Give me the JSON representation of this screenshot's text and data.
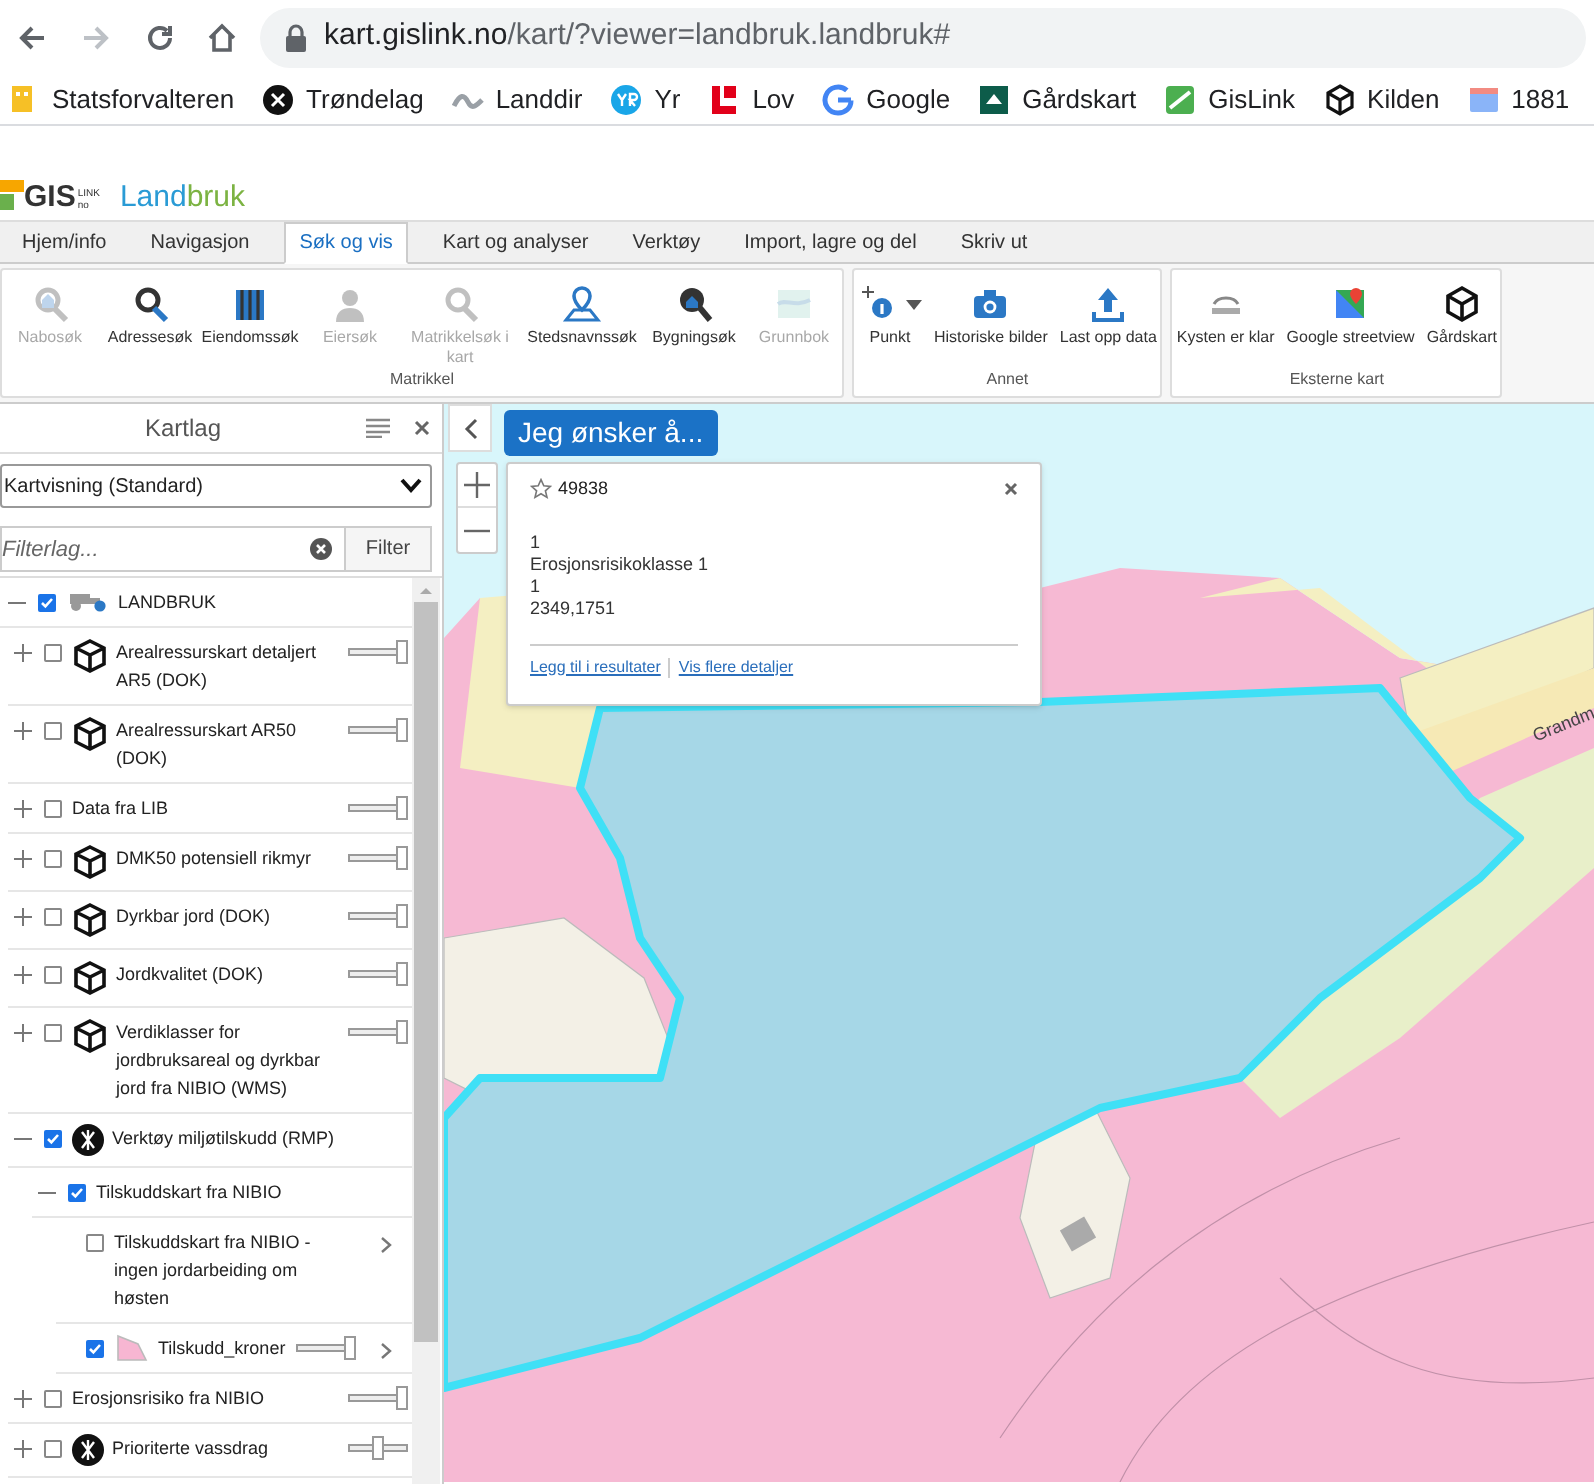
{
  "browser": {
    "url_host": "kart.gislink.no",
    "url_path": "/kart/?viewer=landbruk.landbruk#"
  },
  "bookmarks": [
    "Statsforvalteren",
    "Trøndelag",
    "Landdir",
    "Yr",
    "Lov",
    "Google",
    "Gårdskart",
    "GisLink",
    "Kilden",
    "1881"
  ],
  "logo": {
    "brand": "GIS",
    "brand_sup": "LINK",
    "brand_sub": "no",
    "app_first": "Land",
    "app_second": "bruk"
  },
  "tabs": [
    {
      "label": "Hjem/info",
      "selected": false
    },
    {
      "label": "Navigasjon",
      "selected": false
    },
    {
      "label": "Søk og vis",
      "selected": true
    },
    {
      "label": "Kart og analyser",
      "selected": false
    },
    {
      "label": "Verktøy",
      "selected": false
    },
    {
      "label": "Import, lagre og del",
      "selected": false
    },
    {
      "label": "Skriv ut",
      "selected": false
    }
  ],
  "ribbon_groups": [
    {
      "label": "Matrikkel",
      "buttons": [
        {
          "label": "Nabosøk",
          "disabled": true
        },
        {
          "label": "Adressesøk",
          "disabled": false
        },
        {
          "label": "Eiendomssøk",
          "disabled": false
        },
        {
          "label": "Eiersøk",
          "disabled": true
        },
        {
          "label": "Matrikkelsøk i kart",
          "disabled": true
        },
        {
          "label": "Stedsnavnssøk",
          "disabled": false
        },
        {
          "label": "Bygningsøk",
          "disabled": false
        },
        {
          "label": "Grunnbok",
          "disabled": true
        }
      ]
    },
    {
      "label": "Annet",
      "buttons": [
        {
          "label": "Punkt",
          "disabled": false,
          "dropdown": true
        },
        {
          "label": "Historiske bilder",
          "disabled": false
        },
        {
          "label": "Last opp data",
          "disabled": false
        }
      ]
    },
    {
      "label": "Eksterne kart",
      "buttons": [
        {
          "label": "Kysten er klar",
          "disabled": false
        },
        {
          "label": "Google streetview",
          "disabled": false
        },
        {
          "label": "Gårdskart",
          "disabled": false
        }
      ]
    }
  ],
  "sidebar": {
    "title": "Kartlag",
    "view_select": "Kartvisning (Standard)",
    "filter_placeholder": "Filterlag...",
    "filter_button": "Filter",
    "layers": [
      {
        "label": "LANDBRUK",
        "kind": "tractor",
        "expanded": true,
        "checked": true,
        "children": [
          {
            "label": "Arealressurskart detaljert AR5 (DOK)",
            "kind": "cube",
            "expanded": false,
            "checked": false,
            "level": 1
          },
          {
            "label": "Arealressurskart AR50 (DOK)",
            "kind": "cube",
            "expanded": false,
            "checked": false,
            "level": 1
          },
          {
            "label": "Data fra LIB",
            "expanded": false,
            "checked": false,
            "level": 1
          },
          {
            "label": "DMK50 potensiell rikmyr",
            "kind": "cube",
            "expanded": false,
            "checked": false,
            "level": 1
          },
          {
            "label": "Dyrkbar jord (DOK)",
            "kind": "cube",
            "expanded": false,
            "checked": false,
            "level": 1
          },
          {
            "label": "Jordkvalitet (DOK)",
            "kind": "cube",
            "expanded": false,
            "checked": false,
            "level": 1
          },
          {
            "label": "Verdiklasser for jordbruksareal og dyrkbar jord fra NIBIO (WMS)",
            "kind": "cube",
            "expanded": false,
            "checked": false,
            "level": 1
          },
          {
            "label": "Verktøy miljøtilskudd (RMP)",
            "kind": "emblem",
            "expanded": true,
            "checked": true,
            "children": [
              {
                "label": "Tilskuddskart fra NIBIO",
                "expanded": true,
                "checked": true,
                "children": [
                  {
                    "label": "Tilskuddskart fra NIBIO - ingen jordarbeiding om høsten",
                    "checked": false,
                    "details": true
                  },
                  {
                    "label": "Tilskudd_kroner",
                    "kind": "swatch",
                    "checked": true,
                    "level": 1,
                    "details": true
                  }
                ]
              }
            ]
          },
          {
            "label": "Erosjonsrisiko fra NIBIO",
            "expanded": false,
            "checked": false,
            "level": 1
          },
          {
            "label": "Prioriterte vassdrag",
            "kind": "emblem",
            "expanded": false,
            "checked": false,
            "level": 0.5
          }
        ]
      }
    ]
  },
  "map": {
    "action_button": "Jeg ønsker å...",
    "road_label": "Grandm",
    "popup": {
      "title": "49838",
      "lines": [
        "1",
        "Erosjonsrisikoklasse 1",
        "1",
        "2349,1751"
      ],
      "links": [
        "Legg til i resultater",
        "Vis flere detaljer"
      ]
    }
  }
}
